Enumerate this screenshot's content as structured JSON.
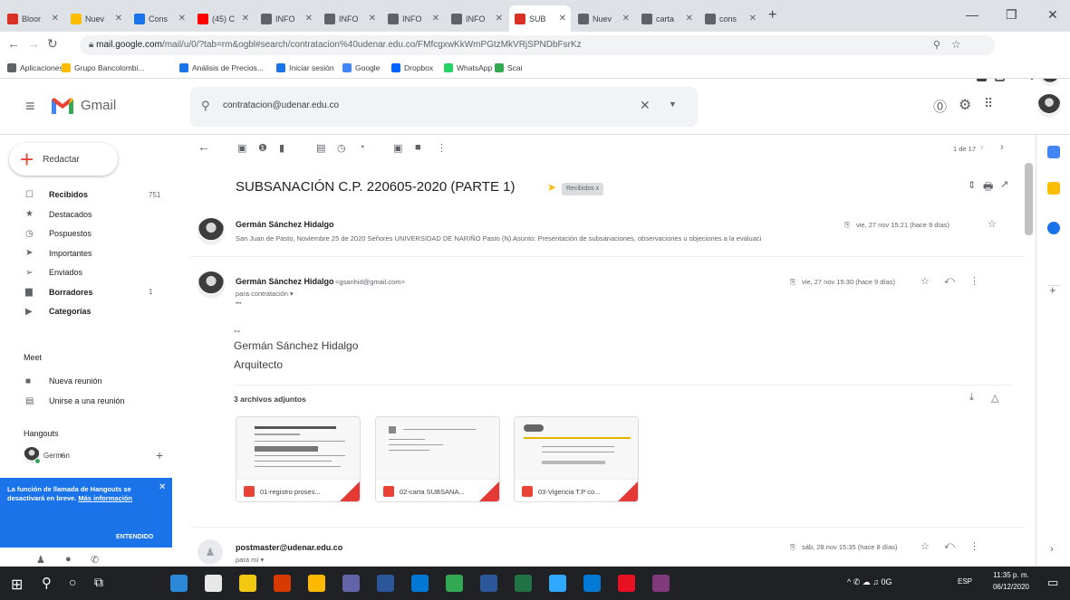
{
  "browser": {
    "tabs": [
      {
        "label": "Bloor",
        "color": "#d93025"
      },
      {
        "label": "Nuev",
        "color": "#fbbc04"
      },
      {
        "label": "Cons",
        "color": "#1a73e8"
      },
      {
        "label": "(45) C",
        "color": "#ff0000"
      },
      {
        "label": "INFO",
        "color": "#5f6368"
      },
      {
        "label": "INFO",
        "color": "#5f6368"
      },
      {
        "label": "INFO",
        "color": "#5f6368"
      },
      {
        "label": "INFO",
        "color": "#5f6368"
      },
      {
        "label": "SUB",
        "color": "#d93025"
      },
      {
        "label": "Nuev",
        "color": "#5f6368"
      },
      {
        "label": "carta",
        "color": "#5f6368"
      },
      {
        "label": "cons",
        "color": "#5f6368"
      }
    ],
    "new_tab": "+",
    "url_domain": "mail.google.com",
    "url_path": "/mail/u/0/?tab=rm&ogbl#search/contratacion%40udenar.edu.co/FMfcgxwKkWmPGtzMkVRjSPNDbFsrKz",
    "bookmarks": [
      {
        "label": "Aplicaciones",
        "color": "#5f6368"
      },
      {
        "label": "Grupo Bancolombi...",
        "color": "#fbbc04"
      },
      {
        "label": "Análisis de Precios...",
        "color": "#1a73e8"
      },
      {
        "label": "Iniciar sesión",
        "color": "#1a73e8"
      },
      {
        "label": "Google",
        "color": "#4285f4"
      },
      {
        "label": "Dropbox",
        "color": "#0061fe"
      },
      {
        "label": "WhatsApp",
        "color": "#25d366"
      },
      {
        "label": "Scai",
        "color": "#34a853"
      }
    ]
  },
  "gmail": {
    "logo_text": "Gmail",
    "search_value": "contratacion@udenar.edu.co",
    "compose_label": "Redactar",
    "nav": [
      {
        "label": "Recibidos",
        "count": "751",
        "icon": "inbox-icon",
        "glyph": "☐",
        "bold": true
      },
      {
        "label": "Destacados",
        "count": "",
        "icon": "star-icon",
        "glyph": "★",
        "bold": false
      },
      {
        "label": "Pospuestos",
        "count": "",
        "icon": "clock-icon",
        "glyph": "◷",
        "bold": false
      },
      {
        "label": "Importantes",
        "count": "",
        "icon": "important-icon",
        "glyph": "➤",
        "bold": false
      },
      {
        "label": "Enviados",
        "count": "",
        "icon": "send-icon",
        "glyph": "➢",
        "bold": false
      },
      {
        "label": "Borradores",
        "count": "1",
        "icon": "draft-icon",
        "glyph": "▆",
        "bold": true
      },
      {
        "label": "Categorías",
        "count": "",
        "icon": "label-icon",
        "glyph": "▶",
        "bold": true
      }
    ],
    "meet_heading": "Meet",
    "meet_items": [
      {
        "label": "Nueva reunión",
        "icon": "video-icon",
        "glyph": "■"
      },
      {
        "label": "Unirse a una reunión",
        "icon": "keyboard-icon",
        "glyph": "▤"
      }
    ],
    "hangouts_heading": "Hangouts",
    "hangouts_user": "Germán",
    "hangouts_banner_text": "La función de llamada de Hangouts se desactivará en breve.",
    "hangouts_banner_link": "Más información",
    "hangouts_banner_button": "ENTENDIDO",
    "pagination": "1 de 17",
    "subject": "SUBSANACIÓN C.P. 220605-2020 (PARTE 1)",
    "label_chip": "Recibidos x",
    "messages": [
      {
        "sender": "Germán Sánchez Hidalgo",
        "date": "vie, 27 nov 15:21 (hace 9 días)",
        "snippet": "San Juan de Pasto, Noviembre 25 de 2020 Señores UNIVERSIDAD DE NARIÑO Pasto (N) Asunto: Presentación de subsanaciones, observaciones u objeciones a la evaluaci"
      },
      {
        "sender": "Germán Sánchez Hidalgo",
        "email": "<gsanhid@gmail.com>",
        "to": "para contratación",
        "date": "vie, 27 nov 15:30 (hace 9 días)",
        "ellipsis": "•••",
        "dash": "--",
        "sig_name": "Germán Sánchez Hidalgo",
        "sig_title": "Arquitecto",
        "attachments_heading": "3 archivos adjuntos",
        "attachments": [
          "01-registro proses...",
          "02-carta SUBSANA...",
          "03-Vigencia T.P co..."
        ]
      },
      {
        "sender": "postmaster@udenar.edu.co",
        "to": "para mí",
        "date": "sáb, 28 nov 15:35 (hace 8 días)"
      }
    ]
  },
  "taskbar": {
    "time": "11:35 p. m.",
    "date": "06/12/2020",
    "lang": "ESP",
    "tray": "^ ✆ ☁ ♫ 0G",
    "apps": [
      "#2b88d8",
      "#e8e8e8",
      "#f2c811",
      "#d83b01",
      "#ffb900",
      "#6264a7",
      "#2b579a",
      "#0078d4",
      "#33a853",
      "#2b579a",
      "#217346",
      "#31a8ff",
      "#0078d4",
      "#e81123",
      "#80397b"
    ]
  }
}
